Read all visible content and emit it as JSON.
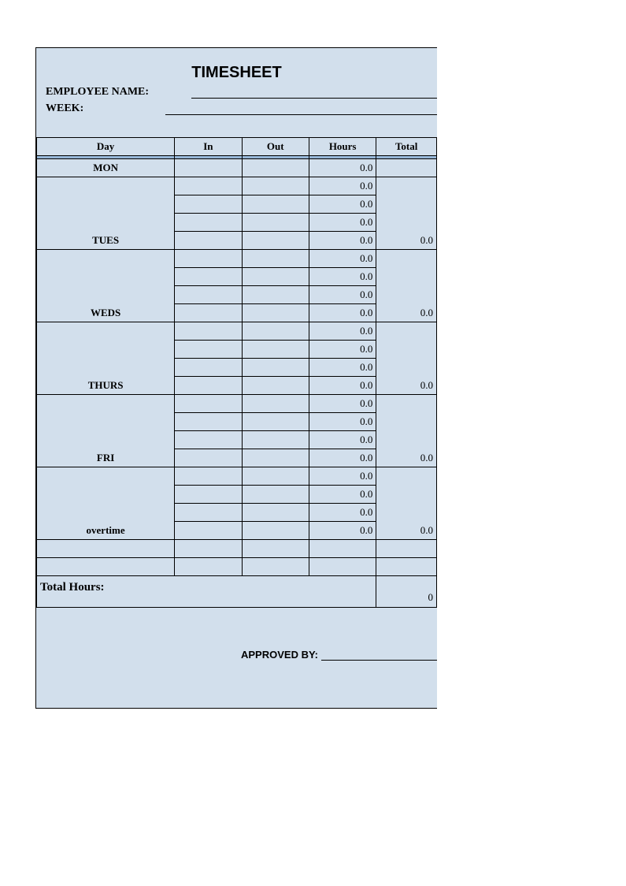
{
  "title": "TIMESHEET",
  "fields": {
    "employee_name_label": "EMPLOYEE NAME:",
    "week_label": "WEEK:"
  },
  "columns": {
    "day": "Day",
    "in": "In",
    "out": "Out",
    "hours": "Hours",
    "total": "Total"
  },
  "days": [
    {
      "label": "MON",
      "rows": [
        {
          "in": "",
          "out": "",
          "hours": "0.0"
        }
      ],
      "total": ""
    },
    {
      "label": "TUES",
      "rows": [
        {
          "in": "",
          "out": "",
          "hours": "0.0"
        },
        {
          "in": "",
          "out": "",
          "hours": "0.0"
        },
        {
          "in": "",
          "out": "",
          "hours": "0.0"
        },
        {
          "in": "",
          "out": "",
          "hours": "0.0"
        }
      ],
      "total": "0.0"
    },
    {
      "label": "WEDS",
      "rows": [
        {
          "in": "",
          "out": "",
          "hours": "0.0"
        },
        {
          "in": "",
          "out": "",
          "hours": "0.0"
        },
        {
          "in": "",
          "out": "",
          "hours": "0.0"
        },
        {
          "in": "",
          "out": "",
          "hours": "0.0"
        }
      ],
      "total": "0.0"
    },
    {
      "label": "THURS",
      "rows": [
        {
          "in": "",
          "out": "",
          "hours": "0.0"
        },
        {
          "in": "",
          "out": "",
          "hours": "0.0"
        },
        {
          "in": "",
          "out": "",
          "hours": "0.0"
        },
        {
          "in": "",
          "out": "",
          "hours": "0.0"
        }
      ],
      "total": "0.0"
    },
    {
      "label": "FRI",
      "rows": [
        {
          "in": "",
          "out": "",
          "hours": "0.0"
        },
        {
          "in": "",
          "out": "",
          "hours": "0.0"
        },
        {
          "in": "",
          "out": "",
          "hours": "0.0"
        },
        {
          "in": "",
          "out": "",
          "hours": "0.0"
        }
      ],
      "total": "0.0"
    },
    {
      "label": "overtime",
      "rows": [
        {
          "in": "",
          "out": "",
          "hours": "0.0"
        },
        {
          "in": "",
          "out": "",
          "hours": "0.0"
        },
        {
          "in": "",
          "out": "",
          "hours": "0.0"
        },
        {
          "in": "",
          "out": "",
          "hours": "0.0"
        }
      ],
      "total": "0.0"
    }
  ],
  "blank_rows": 2,
  "total_hours": {
    "label": "Total Hours:",
    "value": "0"
  },
  "approved_by_label": "APPROVED BY:"
}
